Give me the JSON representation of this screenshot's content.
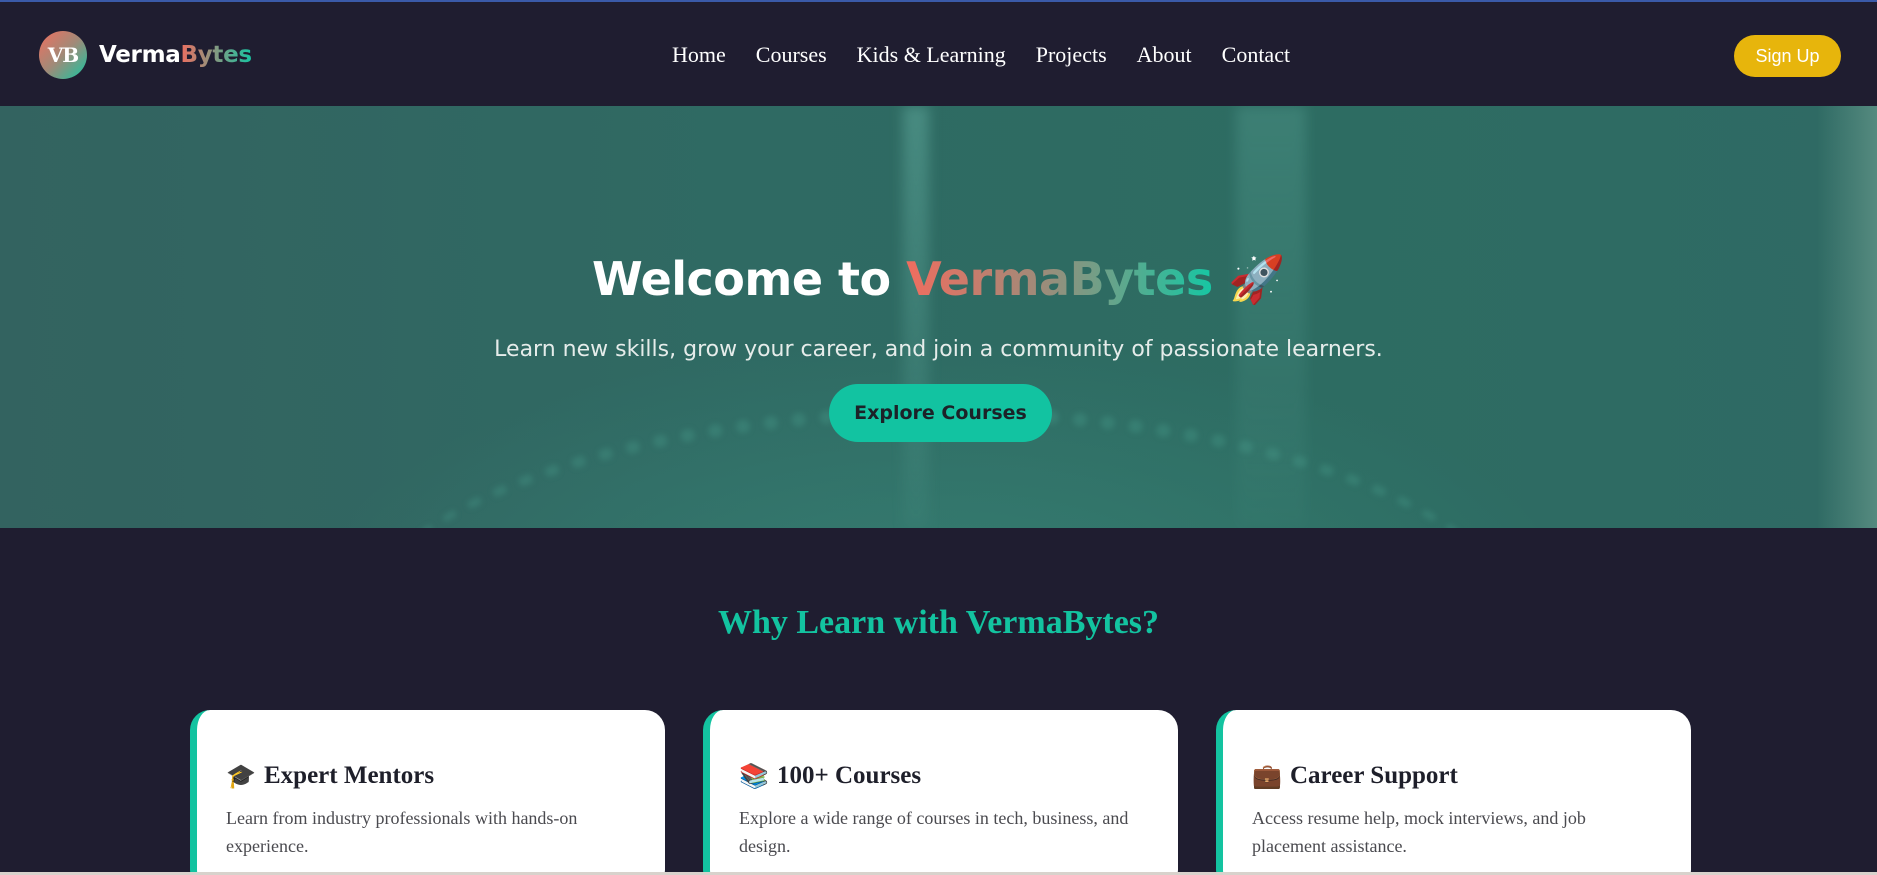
{
  "navbar": {
    "logo_badge": "VB",
    "logo_word1": "Verma",
    "logo_word2": "Bytes",
    "links": [
      "Home",
      "Courses",
      "Kids & Learning",
      "Projects",
      "About",
      "Contact"
    ],
    "signup_label": "Sign Up"
  },
  "hero": {
    "title_prefix": "Welcome to ",
    "title_brand": "VermaBytes",
    "title_emoji": "🚀",
    "subtitle": "Learn new skills, grow your career, and join a community of passionate learners.",
    "cta_label": "Explore Courses"
  },
  "features": {
    "title": "Why Learn with VermaBytes?",
    "cards": [
      {
        "icon": "🎓",
        "icon_name": "graduation-cap-icon",
        "title": "Expert Mentors",
        "text": "Learn from industry professionals with hands-on experience."
      },
      {
        "icon": "📚",
        "icon_name": "books-icon",
        "title": "100+ Courses",
        "text": "Explore a wide range of courses in tech, business, and design."
      },
      {
        "icon": "💼",
        "icon_name": "briefcase-icon",
        "title": "Career Support",
        "text": "Access resume help, mock interviews, and job placement assistance."
      }
    ]
  },
  "colors": {
    "background": "#1f1d30",
    "accent_teal": "#13c3a0",
    "signup_yellow": "#e7b50c",
    "brand_coral": "#f06d5f"
  }
}
